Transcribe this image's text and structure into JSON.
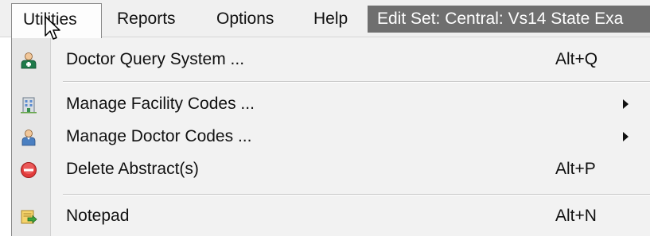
{
  "menubar": {
    "items": [
      {
        "label": "Utilities"
      },
      {
        "label": "Reports"
      },
      {
        "label": "Options"
      },
      {
        "label": "Help"
      }
    ],
    "edit_set": "Edit Set: Central: Vs14 State Exa"
  },
  "dropdown": {
    "items": [
      {
        "label": "Doctor Query System ...",
        "shortcut": "Alt+Q",
        "icon": "doctor-icon"
      },
      {
        "label": "Manage Facility Codes ...",
        "shortcut": "",
        "submenu": true,
        "icon": "building-icon"
      },
      {
        "label": "Manage Doctor Codes ...",
        "shortcut": "",
        "submenu": true,
        "icon": "person-icon"
      },
      {
        "label": "Delete Abstract(s)",
        "shortcut": "Alt+P",
        "icon": "delete-icon"
      },
      {
        "label": "Notepad",
        "shortcut": "Alt+N",
        "icon": "notepad-icon"
      }
    ]
  },
  "colors": {
    "menubar_bg": "#f0f0f0",
    "edit_set_bg": "#6f6f6f",
    "dropdown_bg": "#f2f2f2",
    "delete_red": "#e23b3b",
    "doctor_green": "#1f7a4a"
  }
}
